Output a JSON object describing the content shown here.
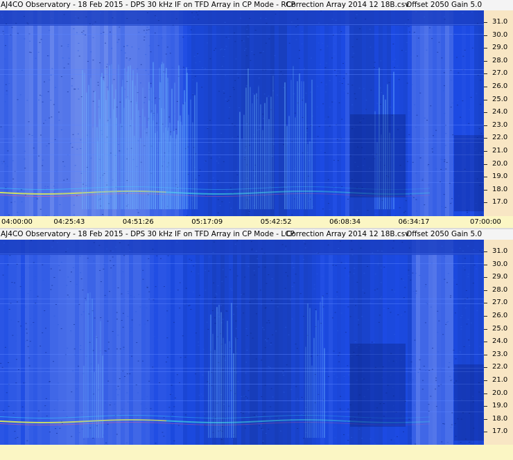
{
  "panels": [
    {
      "title": {
        "observatory": "AJ4CO Observatory - 18 Feb 2015 - DPS 30 kHz IF on TFD Array in CP Mode - RCP",
        "correction": "Correction Array 2014 12 18B.csv",
        "offset": "Offset 2050",
        "gain": "Gain 5.0"
      },
      "polarization": "RCP",
      "y_ticks": [
        "31.0",
        "30.0",
        "29.0",
        "28.0",
        "27.0",
        "26.0",
        "25.0",
        "24.0",
        "23.0",
        "22.0",
        "21.0",
        "20.0",
        "19.0",
        "18.0",
        "17.0"
      ],
      "x_ticks": [
        "04:00:00",
        "04:25:43",
        "04:51:26",
        "05:17:09",
        "05:42:52",
        "06:08:34",
        "06:34:17",
        "07:00:00"
      ]
    },
    {
      "title": {
        "observatory": "AJ4CO Observatory - 18 Feb 2015 - DPS 30 kHz IF on TFD Array in CP Mode - LCP",
        "correction": "Correction Array 2014 12 18B.csv",
        "offset": "Offset 2050",
        "gain": "Gain 5.0"
      },
      "polarization": "LCP",
      "y_ticks": [
        "31.0",
        "30.0",
        "29.0",
        "28.0",
        "27.0",
        "26.0",
        "25.0",
        "24.0",
        "23.0",
        "22.0",
        "21.0",
        "20.0",
        "19.0",
        "18.0",
        "17.0"
      ],
      "x_ticks": []
    }
  ],
  "colors": {
    "background": "#1537ae",
    "axis_bg": "#f8e6c4",
    "time_axis_bg": "#fbf6c4"
  }
}
